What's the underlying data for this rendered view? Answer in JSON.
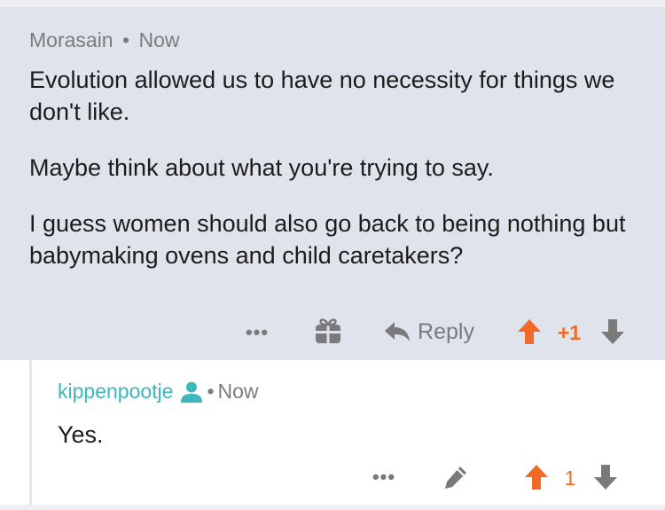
{
  "parent_comment": {
    "author": "Morasain",
    "separator": "•",
    "time": "Now",
    "paragraphs": [
      "Evolution allowed us to have no necessity for things we don't like.",
      "Maybe think about what you're trying to say.",
      "I guess women should also go back to being nothing but babymaking ovens and child caretakers?"
    ],
    "actions": {
      "more_label": "•••",
      "reply_label": "Reply",
      "score": "+1"
    }
  },
  "reply_comment": {
    "author": "kippenpootje",
    "separator": "•",
    "time": "Now",
    "body": "Yes.",
    "actions": {
      "more_label": "•••",
      "score": "1"
    }
  },
  "colors": {
    "parent_bg": "#dfe3ec",
    "upvote": "#f26a28",
    "op_author": "#3cb8ba",
    "icon_gray": "#7a7a7a"
  }
}
